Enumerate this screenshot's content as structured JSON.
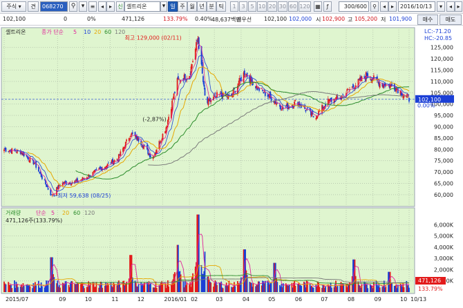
{
  "toolbar": {
    "market_select": "주식",
    "search_label": "견",
    "stock_code": "068270",
    "stock_name": "셀트리온",
    "stock_badge": "신",
    "period_tabs": [
      "일",
      "주",
      "월",
      "년",
      "분",
      "틱"
    ],
    "active_period": "일",
    "minute_options": [
      "1",
      "3",
      "5",
      "10",
      "20",
      "30",
      "60",
      "120"
    ],
    "count": "300/600",
    "date": "2016/10/13"
  },
  "quote": {
    "price": "102,100",
    "change": "0",
    "change_pct": "0%",
    "volume": "471,126",
    "volume_ratio": "133.79%",
    "turnover": "0.40%",
    "amount": "48,637백만",
    "best_bid_label": "최우선",
    "best_bid": "102,100",
    "best_ask": "102,000",
    "open_label": "시",
    "open": "102,900",
    "high_label": "고",
    "high": "105,200",
    "low_label": "저",
    "low": "101,900",
    "buy_label": "매수",
    "sell_label": "매도"
  },
  "chart_data": [
    {
      "type": "candlestick",
      "title": "셀트리온",
      "legend_label": "종가 단순",
      "ma_periods": [
        5,
        10,
        20,
        60,
        120
      ],
      "ma_colors": [
        "#e0229a",
        "#1b3fd6",
        "#e6a700",
        "#2b8c2b",
        "#7a7a7a"
      ],
      "y_ticks": [
        60000,
        65000,
        70000,
        75000,
        80000,
        85000,
        90000,
        95000,
        100000,
        105000,
        110000,
        115000,
        120000,
        125000
      ],
      "y_tick_labels": [
        "60,000",
        "65,000",
        "70,000",
        "75,000",
        "80,000",
        "85,000",
        "90,000",
        "95,000",
        "100,000",
        "105,000",
        "110,000",
        "115,000",
        "120,000",
        "125,000"
      ],
      "ylim": [
        56000,
        131000
      ],
      "x_labels": [
        "2015/07",
        "09",
        "10",
        "11",
        "12",
        "2016/01",
        "02",
        "03",
        "04",
        "05",
        "06",
        "07",
        "08",
        "09",
        "10",
        "10/13"
      ],
      "x_label_dates": [
        "2015-07-01",
        "2015-09-01",
        "2015-10-01",
        "2015-11-01",
        "2015-12-01",
        "2016-01-01",
        "2016-02-01",
        "2016-03-01",
        "2016-04-01",
        "2016-05-01",
        "2016-06-01",
        "2016-07-01",
        "2016-08-01",
        "2016-09-01",
        "2016-10-01",
        "2016-10-13"
      ],
      "date_range": [
        "2015-07-01",
        "2016-10-13"
      ],
      "guide_price": 102100,
      "ohlc_path": [
        [
          "2015-07-01",
          80000
        ],
        [
          "2015-07-20",
          79000
        ],
        [
          "2015-08-05",
          74000
        ],
        [
          "2015-08-25",
          59638
        ],
        [
          "2015-09-05",
          65000
        ],
        [
          "2015-09-25",
          66000
        ],
        [
          "2015-10-10",
          69000
        ],
        [
          "2015-10-28",
          73000
        ],
        [
          "2015-11-10",
          76000
        ],
        [
          "2015-11-25",
          87000
        ],
        [
          "2015-12-05",
          84000
        ],
        [
          "2015-12-20",
          76000
        ],
        [
          "2016-01-05",
          90000
        ],
        [
          "2016-01-18",
          110000
        ],
        [
          "2016-02-01",
          113000
        ],
        [
          "2016-02-11",
          129000
        ],
        [
          "2016-02-20",
          100000
        ],
        [
          "2016-03-05",
          104000
        ],
        [
          "2016-03-20",
          103000
        ],
        [
          "2016-04-05",
          114000
        ],
        [
          "2016-04-20",
          107000
        ],
        [
          "2016-05-05",
          103000
        ],
        [
          "2016-05-20",
          98000
        ],
        [
          "2016-06-05",
          101000
        ],
        [
          "2016-06-25",
          94000
        ],
        [
          "2016-07-10",
          101000
        ],
        [
          "2016-07-25",
          103000
        ],
        [
          "2016-08-10",
          108000
        ],
        [
          "2016-08-25",
          113000
        ],
        [
          "2016-09-10",
          109000
        ],
        [
          "2016-09-25",
          108000
        ],
        [
          "2016-10-13",
          102100
        ]
      ],
      "annotations": {
        "high": {
          "label": "최고 129,000 (02/11)",
          "date": "2016-02-11",
          "price": 129000
        },
        "low": {
          "label": "←최저 59,638 (08/25)",
          "date": "2015-08-25",
          "price": 59638
        },
        "change_note": "(-2,87%)"
      },
      "right_labels": {
        "lc": "LC:-71.20",
        "hc": "HC:-20.85",
        "pct": "0.00%",
        "last_price": "102,100"
      }
    },
    {
      "type": "bar",
      "title": "거래량",
      "legend_label": "단순",
      "ma_periods": [
        5,
        20,
        60,
        120
      ],
      "ma_colors": [
        "#e0229a",
        "#e6a700",
        "#2b8c2b",
        "#7a7a7a"
      ],
      "summary": "471,126주(133.79%)",
      "y_ticks": [
        1000000,
        2000000,
        3000000,
        4000000,
        5000000,
        6000000
      ],
      "y_tick_labels": [
        "1,000K",
        "2,000K",
        "3,000K",
        "4,000K",
        "5,000K",
        "6,000K"
      ],
      "ylim": [
        0,
        7000000
      ],
      "spikes": [
        [
          "2015-08-25",
          3100000
        ],
        [
          "2015-11-25",
          3300000
        ],
        [
          "2016-01-18",
          4200000
        ],
        [
          "2016-02-11",
          6900000
        ],
        [
          "2016-02-20",
          3600000
        ],
        [
          "2016-04-05",
          3800000
        ],
        [
          "2016-05-10",
          2600000
        ],
        [
          "2016-08-10",
          2900000
        ],
        [
          "2016-09-20",
          1800000
        ]
      ],
      "last_volume_label": "471,126",
      "last_pct_label": "133.79%"
    }
  ]
}
